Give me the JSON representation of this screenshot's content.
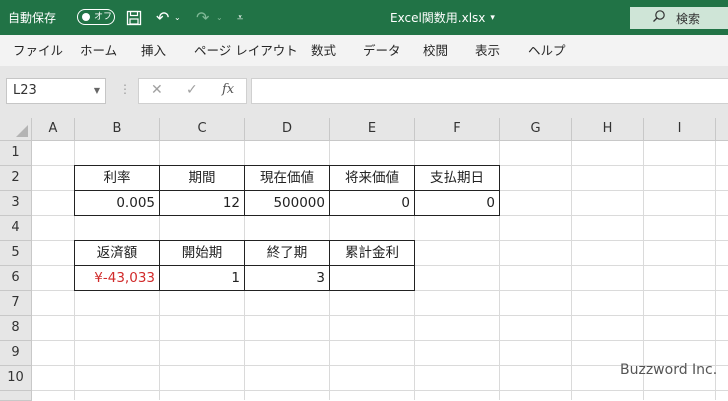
{
  "titlebar": {
    "autosave_label": "自動保存",
    "autosave_state": "オフ",
    "filename": "Excel関数用.xlsx",
    "search_label": "検索",
    "accent_color": "#217346"
  },
  "ribbon": {
    "tabs": [
      "ファイル",
      "ホーム",
      "挿入",
      "ページ レイアウト",
      "数式",
      "データ",
      "校閲",
      "表示",
      "ヘルプ"
    ]
  },
  "formula_bar": {
    "name_box": "L23",
    "fx": "fx",
    "value": ""
  },
  "sheet": {
    "columns": [
      "A",
      "B",
      "C",
      "D",
      "E",
      "F",
      "G",
      "H",
      "I"
    ],
    "rows": [
      "1",
      "2",
      "3",
      "4",
      "5",
      "6",
      "7",
      "8",
      "9",
      "10"
    ],
    "table1": {
      "headers": [
        "利率",
        "期間",
        "現在価値",
        "将来価値",
        "支払期日"
      ],
      "values": [
        "0.005",
        "12",
        "500000",
        "0",
        "0"
      ]
    },
    "table2": {
      "headers": [
        "返済額",
        "開始期",
        "終了期",
        "累計金利"
      ],
      "values": [
        "¥-43,033",
        "1",
        "3",
        ""
      ]
    }
  },
  "watermark": "Buzzword Inc."
}
